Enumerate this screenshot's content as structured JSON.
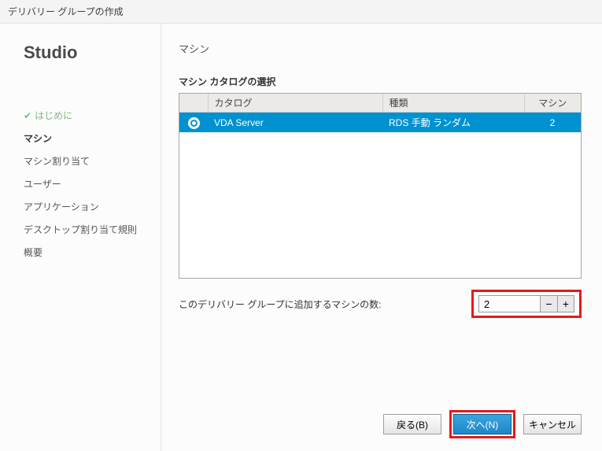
{
  "window_title": "デリバリー グループの作成",
  "brand": "Studio",
  "sidebar": {
    "steps": [
      {
        "label": "はじめに",
        "state": "done"
      },
      {
        "label": "マシン",
        "state": "current"
      },
      {
        "label": "マシン割り当て",
        "state": ""
      },
      {
        "label": "ユーザー",
        "state": ""
      },
      {
        "label": "アプリケーション",
        "state": ""
      },
      {
        "label": "デスクトップ割り当て規則",
        "state": ""
      },
      {
        "label": "概要",
        "state": ""
      }
    ]
  },
  "content": {
    "section_title": "マシン",
    "sub_title": "マシン カタログの選択",
    "columns": {
      "catalog": "カタログ",
      "type": "種類",
      "machines": "マシン"
    },
    "rows": [
      {
        "catalog": "VDA Server",
        "type": "RDS 手動 ランダム",
        "machines": "2",
        "selected": true
      }
    ],
    "count_label": "このデリバリー グループに追加するマシンの数:",
    "count_value": "2"
  },
  "footer": {
    "back": "戻る(B)",
    "next": "次へ(N)",
    "cancel": "キャンセル"
  }
}
